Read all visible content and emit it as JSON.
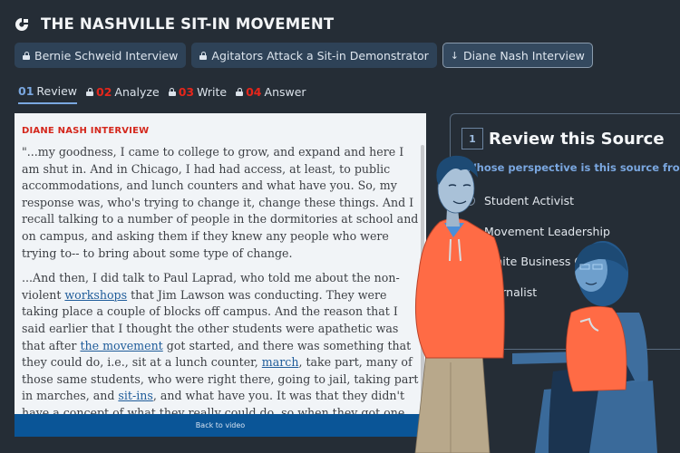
{
  "header": {
    "logo_icon": "c-logo-icon",
    "title": "THE NASHVILLE SIT-IN MOVEMENT"
  },
  "source_tabs": [
    {
      "label": "Bernie Schweid Interview",
      "icon": "lock-icon",
      "active": false
    },
    {
      "label": "Agitators Attack a Sit-in Demonstrator",
      "icon": "lock-icon",
      "active": false
    },
    {
      "label": "Diane Nash Interview",
      "icon": "arrow-down-icon",
      "active": true
    }
  ],
  "steps": [
    {
      "num": "01",
      "label": "Review",
      "locked": false,
      "active": true
    },
    {
      "num": "02",
      "label": "Analyze",
      "locked": true,
      "active": false
    },
    {
      "num": "03",
      "label": "Write",
      "locked": true,
      "active": false
    },
    {
      "num": "04",
      "label": "Answer",
      "locked": true,
      "active": false
    }
  ],
  "reader": {
    "title": "DIANE NASH INTERVIEW",
    "p1": "\"...my goodness, I came to college to grow, and expand and here I am shut in. And in Chicago, I had had access, at least, to public accommodations, and lunch counters and what have you. So, my response was, who's trying to change it, change these things. And I recall talking to a number of people in the dormitories at school and on campus, and asking them if they knew any people who were trying to-- to bring about some type of change.",
    "p2_a": "...And then, I did talk to Paul Laprad, who told me about the non-violent ",
    "link_workshops": "workshops",
    "p2_b": " that Jim Lawson was conducting. They were taking place a couple of blocks off campus. And the reason that I said earlier that I thought the other students were apathetic was that after ",
    "link_movement": "the movement",
    "p2_c": " got started, and there was something that they could do, i.e., sit at a lunch counter, ",
    "link_march": "march",
    "p2_d": ", take part, many of those same students, who were right there, going to jail, taking part in marches, and ",
    "link_sitins": "sit-ins",
    "p2_e": ", and what have you. It was that they didn't have a concept of what they really could do, so when they got one, they were on fire. They",
    "back_button": "Back to video"
  },
  "panel": {
    "step_number": "1",
    "title": "Review this Source",
    "question": "Whose perspective is this source from?",
    "options": [
      "Student Activist",
      "Movement Leadership",
      "White Business Owner",
      "Journalist"
    ]
  },
  "colors": {
    "background": "#252d36",
    "accent_blue": "#7aa7e0",
    "step_red": "#e5261b",
    "reader_title_red": "#d4271c",
    "back_button_blue": "#0a5597",
    "hoodie_orange": "#ff6b45"
  }
}
